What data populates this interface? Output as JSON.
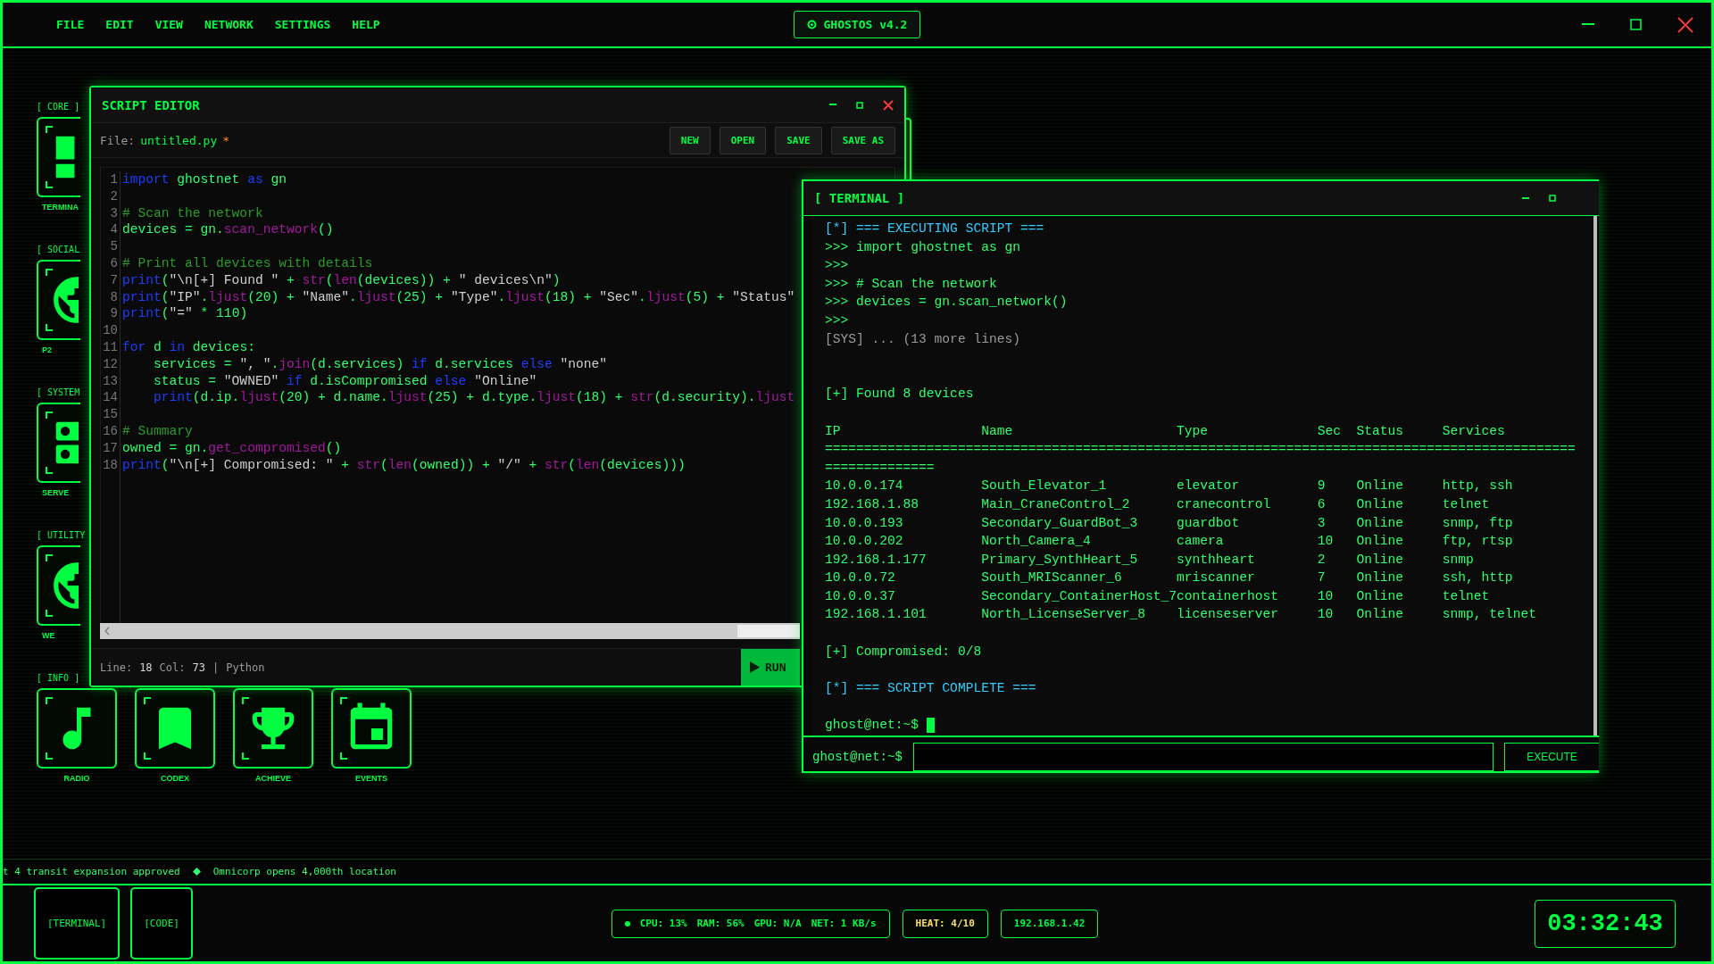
{
  "menu_bar": {
    "menus": [
      "FILE",
      "EDIT",
      "VIEW",
      "NETWORK",
      "SETTINGS",
      "HELP"
    ],
    "badge": "GHOSTOS v4.2"
  },
  "dock": [
    {
      "section": "[ CORE ]",
      "apps": [
        {
          "kind": "core",
          "label": "TERMINA"
        }
      ]
    },
    {
      "section": "[ SOCIAL",
      "apps": [
        {
          "kind": "globe",
          "label": "P2"
        }
      ]
    },
    {
      "section": "[ SYSTEM",
      "apps": [
        {
          "kind": "server",
          "label": "SERVE"
        }
      ]
    },
    {
      "section": "[ UTILITY",
      "apps": [
        {
          "kind": "globe",
          "label": "WE"
        }
      ]
    },
    {
      "section": "[ INFO ]",
      "apps": [
        {
          "kind": "music",
          "label": "RADIO"
        },
        {
          "kind": "book",
          "label": "CODEX"
        },
        {
          "kind": "trophy",
          "label": "ACHIEVE"
        },
        {
          "kind": "calendar",
          "label": "EVENTS"
        }
      ]
    }
  ],
  "editor": {
    "title": "SCRIPT EDITOR",
    "file_label": "File:",
    "file_name": "untitled.py",
    "modified_mark": "*",
    "buttons": [
      "NEW",
      "OPEN",
      "SAVE",
      "SAVE AS"
    ],
    "lines": [
      {
        "n": "1",
        "tokens": [
          {
            "kind": "kw",
            "text": "import"
          },
          {
            "kind": "tx",
            "text": " ghostnet "
          },
          {
            "kind": "kw",
            "text": "as"
          },
          {
            "kind": "tx",
            "text": " gn"
          }
        ]
      },
      {
        "n": "2"
      },
      {
        "n": "3",
        "tokens": [
          {
            "kind": "cmt",
            "text": "# Scan the network"
          }
        ]
      },
      {
        "n": "4",
        "tokens": [
          {
            "kind": "tx",
            "text": "devices = gn."
          },
          {
            "kind": "fn",
            "text": "scan_network"
          },
          {
            "kind": "tx",
            "text": "()"
          }
        ]
      },
      {
        "n": "5"
      },
      {
        "n": "6",
        "tokens": [
          {
            "kind": "cmt",
            "text": "# Print all devices with details"
          }
        ]
      },
      {
        "n": "7",
        "tokens": [
          {
            "kind": "kw",
            "text": "print"
          },
          {
            "kind": "tx",
            "text": "("
          },
          {
            "kind": "str",
            "text": "\"\\n[+] Found \""
          },
          {
            "kind": "tx",
            "text": " + "
          },
          {
            "kind": "fn",
            "text": "str"
          },
          {
            "kind": "tx",
            "text": "("
          },
          {
            "kind": "fn",
            "text": "len"
          },
          {
            "kind": "tx",
            "text": "(devices)) + "
          },
          {
            "kind": "str",
            "text": "\" devices\\n\""
          },
          {
            "kind": "tx",
            "text": ")"
          }
        ]
      },
      {
        "n": "8",
        "tokens": [
          {
            "kind": "kw",
            "text": "print"
          },
          {
            "kind": "tx",
            "text": "("
          },
          {
            "kind": "str",
            "text": "\"IP\""
          },
          {
            "kind": "tx",
            "text": "."
          },
          {
            "kind": "fn",
            "text": "ljust"
          },
          {
            "kind": "tx",
            "text": "(20) + "
          },
          {
            "kind": "str",
            "text": "\"Name\""
          },
          {
            "kind": "tx",
            "text": "."
          },
          {
            "kind": "fn",
            "text": "ljust"
          },
          {
            "kind": "tx",
            "text": "(25) + "
          },
          {
            "kind": "str",
            "text": "\"Type\""
          },
          {
            "kind": "tx",
            "text": "."
          },
          {
            "kind": "fn",
            "text": "ljust"
          },
          {
            "kind": "tx",
            "text": "(18) + "
          },
          {
            "kind": "str",
            "text": "\"Sec\""
          },
          {
            "kind": "tx",
            "text": "."
          },
          {
            "kind": "fn",
            "text": "ljust"
          },
          {
            "kind": "tx",
            "text": "(5) + "
          },
          {
            "kind": "str",
            "text": "\"Status\""
          }
        ]
      },
      {
        "n": "9",
        "tokens": [
          {
            "kind": "kw",
            "text": "print"
          },
          {
            "kind": "tx",
            "text": "("
          },
          {
            "kind": "str",
            "text": "\"=\""
          },
          {
            "kind": "tx",
            "text": " * 110)"
          }
        ]
      },
      {
        "n": "10"
      },
      {
        "n": "11",
        "tokens": [
          {
            "kind": "kw",
            "text": "for"
          },
          {
            "kind": "tx",
            "text": " d "
          },
          {
            "kind": "kw",
            "text": "in"
          },
          {
            "kind": "tx",
            "text": " devices:"
          }
        ]
      },
      {
        "n": "12",
        "tokens": [
          {
            "kind": "tx",
            "text": "    services = "
          },
          {
            "kind": "str",
            "text": "\", \""
          },
          {
            "kind": "tx",
            "text": "."
          },
          {
            "kind": "fn",
            "text": "join"
          },
          {
            "kind": "tx",
            "text": "(d.services) "
          },
          {
            "kind": "kw",
            "text": "if"
          },
          {
            "kind": "tx",
            "text": " d.services "
          },
          {
            "kind": "kw",
            "text": "else "
          },
          {
            "kind": "str",
            "text": "\"none\""
          }
        ]
      },
      {
        "n": "13",
        "tokens": [
          {
            "kind": "tx",
            "text": "    status = "
          },
          {
            "kind": "str",
            "text": "\"OWNED\" "
          },
          {
            "kind": "kw",
            "text": "if"
          },
          {
            "kind": "tx",
            "text": " d.isCompromised "
          },
          {
            "kind": "kw",
            "text": "else "
          },
          {
            "kind": "str",
            "text": "\"Online\""
          }
        ]
      },
      {
        "n": "14",
        "tokens": [
          {
            "kind": "kw",
            "text": "    print"
          },
          {
            "kind": "tx",
            "text": "(d.ip."
          },
          {
            "kind": "fn",
            "text": "ljust"
          },
          {
            "kind": "tx",
            "text": "(20) + d.name."
          },
          {
            "kind": "fn",
            "text": "ljust"
          },
          {
            "kind": "tx",
            "text": "(25) + d.type."
          },
          {
            "kind": "fn",
            "text": "ljust"
          },
          {
            "kind": "tx",
            "text": "(18) + "
          },
          {
            "kind": "fn",
            "text": "str"
          },
          {
            "kind": "tx",
            "text": "(d.security)."
          },
          {
            "kind": "fn",
            "text": "ljust"
          }
        ]
      },
      {
        "n": "15"
      },
      {
        "n": "16",
        "tokens": [
          {
            "kind": "cmt",
            "text": "# Summary"
          }
        ]
      },
      {
        "n": "17",
        "tokens": [
          {
            "kind": "tx",
            "text": "owned = gn."
          },
          {
            "kind": "fn",
            "text": "get_compromised"
          },
          {
            "kind": "tx",
            "text": "()"
          }
        ]
      },
      {
        "n": "18",
        "tokens": [
          {
            "kind": "kw",
            "text": "print"
          },
          {
            "kind": "tx",
            "text": "("
          },
          {
            "kind": "str",
            "text": "\"\\n[+] Compromised: \""
          },
          {
            "kind": "tx",
            "text": " + "
          },
          {
            "kind": "fn",
            "text": "str"
          },
          {
            "kind": "tx",
            "text": "("
          },
          {
            "kind": "fn",
            "text": "len"
          },
          {
            "kind": "tx",
            "text": "(owned)) + "
          },
          {
            "kind": "str",
            "text": "\"/\""
          },
          {
            "kind": "tx",
            "text": " + "
          },
          {
            "kind": "fn",
            "text": "str"
          },
          {
            "kind": "tx",
            "text": "("
          },
          {
            "kind": "fn",
            "text": "len"
          },
          {
            "kind": "tx",
            "text": "(devices)))"
          }
        ]
      }
    ],
    "status": {
      "line_label": "Line:",
      "line": "18",
      "col_label": "Col:",
      "col": "73",
      "separator": "|",
      "language": "Python"
    },
    "run_button": "RUN"
  },
  "terminal": {
    "title": "[ TERMINAL ]",
    "output": [
      {
        "kind": "line",
        "color": "#33ccff",
        "text": "[*] === EXECUTING SCRIPT ==="
      },
      {
        "kind": "line",
        "color": "#2eff6a",
        "text": ">>> import ghostnet as gn"
      },
      {
        "kind": "line",
        "color": "#2eff6a",
        "text": ">>>"
      },
      {
        "kind": "line",
        "color": "#2eff6a",
        "text": ">>> # Scan the network"
      },
      {
        "kind": "line",
        "color": "#2eff6a",
        "text": ">>> devices = gn.scan_network()"
      },
      {
        "kind": "line",
        "color": "#2eff6a",
        "text": ">>>"
      },
      {
        "kind": "line",
        "color": "#9a9a9a",
        "text": "[SYS] ... (13 more lines)"
      },
      {
        "kind": "blank"
      },
      {
        "kind": "blank"
      },
      {
        "kind": "line",
        "color": "#2eff6a",
        "text": "[+] Found 8 devices"
      },
      {
        "kind": "blank"
      },
      {
        "kind": "table",
        "columns": [
          "IP",
          "Name",
          "Type",
          "Sec",
          "Status",
          "Services"
        ],
        "separator": "==============================================================================================================",
        "rows": [
          [
            "10.0.0.174",
            "South_Elevator_1",
            "elevator",
            "9",
            "Online",
            "http, ssh"
          ],
          [
            "192.168.1.88",
            "Main_CraneControl_2",
            "cranecontrol",
            "6",
            "Online",
            "telnet"
          ],
          [
            "10.0.0.193",
            "Secondary_GuardBot_3",
            "guardbot",
            "3",
            "Online",
            "snmp, ftp"
          ],
          [
            "10.0.0.202",
            "North_Camera_4",
            "camera",
            "10",
            "Online",
            "ftp, rtsp"
          ],
          [
            "192.168.1.177",
            "Primary_SynthHeart_5",
            "synthheart",
            "2",
            "Online",
            "snmp"
          ],
          [
            "10.0.0.72",
            "South_MRIScanner_6",
            "mriscanner",
            "7",
            "Online",
            "ssh, http"
          ],
          [
            "10.0.0.37",
            "Secondary_ContainerHost_7",
            "containerhost",
            "10",
            "Online",
            "telnet"
          ],
          [
            "192.168.1.101",
            "North_LicenseServer_8",
            "licenseserver",
            "10",
            "Online",
            "snmp, telnet"
          ]
        ]
      },
      {
        "kind": "blank"
      },
      {
        "kind": "line",
        "color": "#2eff6a",
        "text": "[+] Compromised: 0/8"
      },
      {
        "kind": "blank"
      },
      {
        "kind": "line",
        "color": "#33ccff",
        "text": "[*] === SCRIPT COMPLETE ==="
      },
      {
        "kind": "blank"
      },
      {
        "kind": "prompt",
        "text": "ghost@net:~$"
      }
    ],
    "input_prompt": "ghost@net:~$",
    "execute_button": "EXECUTE"
  },
  "ticker": [
    "t 4 transit expansion approved",
    "Omnicorp opens 4,000th location"
  ],
  "taskbar": {
    "tasks": [
      "[TERMINAL]",
      "[CODE]"
    ],
    "stats": [
      "CPU: 13%",
      "RAM: 56%",
      "GPU: N/A",
      "NET: 1 KB/s"
    ],
    "heat": "HEAT: 4/10",
    "ip": "192.168.1.42",
    "clock": "03:32:43"
  }
}
